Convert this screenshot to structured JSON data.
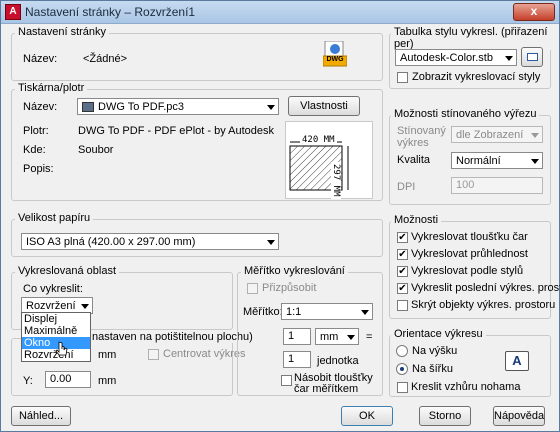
{
  "window": {
    "title": "Nastavení stránky – Rozvržení1",
    "close": "x"
  },
  "page_setup": {
    "label": "Nastavení stránky",
    "name_label": "Název:",
    "name_value": "<Žádné>",
    "dwg_badge": "DWG"
  },
  "printer": {
    "label": "Tiskárna/plotr",
    "name_label": "Název:",
    "name_value": "DWG To PDF.pc3",
    "properties_button": "Vlastnosti",
    "plotter_label": "Plotr:",
    "plotter_value": "DWG To PDF - PDF ePlot - by Autodesk",
    "where_label": "Kde:",
    "where_value": "Soubor",
    "desc_label": "Popis:",
    "preview_width": "420 MM",
    "preview_height": "297 MM"
  },
  "paper": {
    "label": "Velikost papíru",
    "value": "ISO A3 plná (420.00 x 297.00 mm)"
  },
  "plot_area": {
    "label": "Vykreslovaná oblast",
    "what_label": "Co vykreslit:",
    "value": "Rozvržení",
    "options": [
      "Displej",
      "Maximálně",
      "Okno",
      "Rozvržení"
    ],
    "selected_option": "Okno"
  },
  "offset": {
    "label": "nastaven na potištitelnou plochu)",
    "mm_x": "mm",
    "mm_y": "mm",
    "center_label": "Centrovat výkres",
    "y_label": "Y:",
    "y_value": "0.00"
  },
  "scale": {
    "label": "Měřítko vykreslování",
    "fit_label": "Přizpůsobit",
    "scale_label": "Měřítko:",
    "scale_value": "1:1",
    "value1": "1",
    "unit_value": "mm",
    "equals": "=",
    "value2": "1",
    "unit_label": "jednotka",
    "lineweights_label": "Násobit tloušťky čar měřítkem"
  },
  "plot_style": {
    "label": "Tabulka stylu vykresl. (přiřazení per)",
    "value": "Autodesk-Color.stb",
    "show_label": "Zobrazit vykreslovací styly"
  },
  "shaded": {
    "label": "Možnosti stínovaného výřezu",
    "shaded_label": "Stínovaný výkres",
    "shaded_value": "dle Zobrazení",
    "quality_label": "Kvalita",
    "quality_value": "Normální",
    "dpi_label": "DPI",
    "dpi_value": "100"
  },
  "options": {
    "label": "Možnosti",
    "items": [
      "Vykreslovat tloušťku čar",
      "Vykreslovat průhlednost",
      "Vykreslovat podle stylů",
      "Vykreslit poslední výkres. prostoru",
      "Skrýt objekty výkres. prostoru"
    ],
    "checked": [
      true,
      true,
      true,
      true,
      false
    ]
  },
  "orientation": {
    "label": "Orientace výkresu",
    "portrait": "Na výšku",
    "landscape": "Na šířku",
    "upside_down": "Kreslit vzhůru nohama",
    "icon_letter": "A"
  },
  "buttons": {
    "preview": "Náhled...",
    "ok": "OK",
    "cancel": "Storno",
    "help": "Nápověda"
  }
}
